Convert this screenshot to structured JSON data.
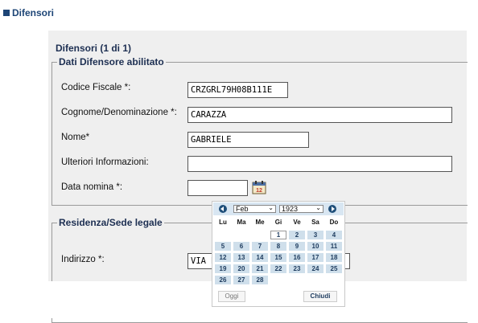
{
  "top_tab": {
    "label": "Difensori"
  },
  "panel": {
    "title": "Difensori (1 di 1)"
  },
  "section1": {
    "legend": "Dati Difensore abilitato",
    "codice_fiscale": {
      "label": "Codice Fiscale *:",
      "value": "CRZGRL79H08B111E"
    },
    "cognome": {
      "label": "Cognome/Denominazione *:",
      "value": "CARAZZA"
    },
    "nome": {
      "label": "Nome*",
      "value": "GABRIELE"
    },
    "ulteriori": {
      "label": "Ulteriori Informazioni:",
      "value": ""
    },
    "data_nomina": {
      "label": "Data nomina *:",
      "value": "",
      "calendar_icon_text": "12"
    }
  },
  "section2": {
    "legend": "Residenza/Sede legale",
    "indirizzo": {
      "label": "Indirizzo *:",
      "value": "VIA DI"
    }
  },
  "calendar": {
    "month": "Feb",
    "year": "1923",
    "weekdays": [
      "Lu",
      "Ma",
      "Me",
      "Gi",
      "Ve",
      "Sa",
      "Do"
    ],
    "weeks": [
      [
        "",
        "",
        "",
        "1",
        "2",
        "3",
        "4"
      ],
      [
        "5",
        "6",
        "7",
        "8",
        "9",
        "10",
        "11"
      ],
      [
        "12",
        "13",
        "14",
        "15",
        "16",
        "17",
        "18"
      ],
      [
        "19",
        "20",
        "21",
        "22",
        "23",
        "24",
        "25"
      ],
      [
        "26",
        "27",
        "28",
        "",
        "",
        "",
        ""
      ]
    ],
    "today_label": "Oggi",
    "close_label": "Chiudi"
  }
}
